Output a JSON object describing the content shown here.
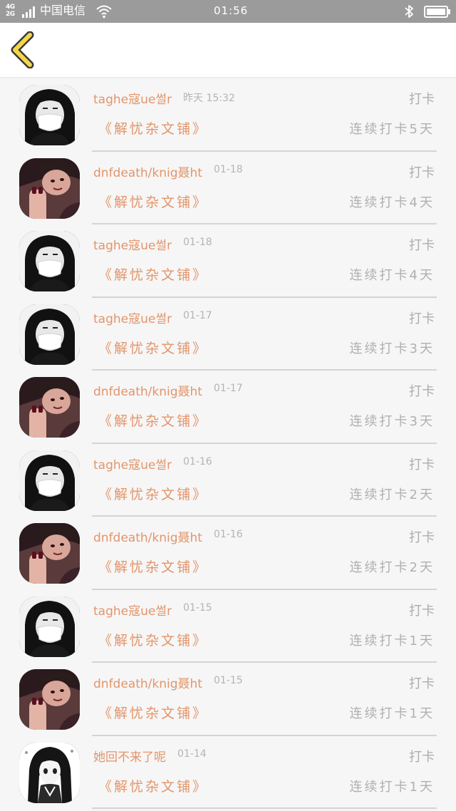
{
  "status_bar": {
    "network_top": "4G",
    "network_bottom": "2G",
    "carrier": "中国电信",
    "time": "01:56",
    "colors": {
      "background": "#9b9b9b",
      "foreground": "#ffffff"
    }
  },
  "nav": {
    "back_icon": "chevron-left-icon",
    "back_icon_color": "#f5d64a"
  },
  "list": {
    "clock_label": "打卡",
    "book_title": "《解忧杂文铺》",
    "items": [
      {
        "name": "taghe寇ue썰r",
        "time": "昨天 15:32",
        "clock_label": "打卡",
        "book": "《解忧杂文铺》",
        "streak": "连续打卡5天",
        "avatar": "girl-mask-avatar"
      },
      {
        "name": "dnfdeath/knig聂ht",
        "time": "01-18",
        "clock_label": "打卡",
        "book": "《解忧杂文铺》",
        "streak": "连续打卡4天",
        "avatar": "woman-hand-avatar"
      },
      {
        "name": "taghe寇ue썰r",
        "time": "01-18",
        "clock_label": "打卡",
        "book": "《解忧杂文铺》",
        "streak": "连续打卡4天",
        "avatar": "girl-mask-avatar"
      },
      {
        "name": "taghe寇ue썰r",
        "time": "01-17",
        "clock_label": "打卡",
        "book": "《解忧杂文铺》",
        "streak": "连续打卡3天",
        "avatar": "girl-mask-avatar"
      },
      {
        "name": "dnfdeath/knig聂ht",
        "time": "01-17",
        "clock_label": "打卡",
        "book": "《解忧杂文铺》",
        "streak": "连续打卡3天",
        "avatar": "woman-hand-avatar"
      },
      {
        "name": "taghe寇ue썰r",
        "time": "01-16",
        "clock_label": "打卡",
        "book": "《解忧杂文铺》",
        "streak": "连续打卡2天",
        "avatar": "girl-mask-avatar"
      },
      {
        "name": "dnfdeath/knig聂ht",
        "time": "01-16",
        "clock_label": "打卡",
        "book": "《解忧杂文铺》",
        "streak": "连续打卡2天",
        "avatar": "woman-hand-avatar"
      },
      {
        "name": "taghe寇ue썰r",
        "time": "01-15",
        "clock_label": "打卡",
        "book": "《解忧杂文铺》",
        "streak": "连续打卡1天",
        "avatar": "girl-mask-avatar"
      },
      {
        "name": "dnfdeath/knig聂ht",
        "time": "01-15",
        "clock_label": "打卡",
        "book": "《解忧杂文铺》",
        "streak": "连续打卡1天",
        "avatar": "woman-hand-avatar"
      },
      {
        "name": "她回不来了呢",
        "time": "01-14",
        "clock_label": "打卡",
        "book": "《解忧杂文铺》",
        "streak": "连续打卡1天",
        "avatar": "anime-girl-avatar"
      }
    ]
  },
  "colors": {
    "accent": "#e3956b",
    "muted_text": "#b0b0b0",
    "page_background": "#f6f6f6"
  }
}
